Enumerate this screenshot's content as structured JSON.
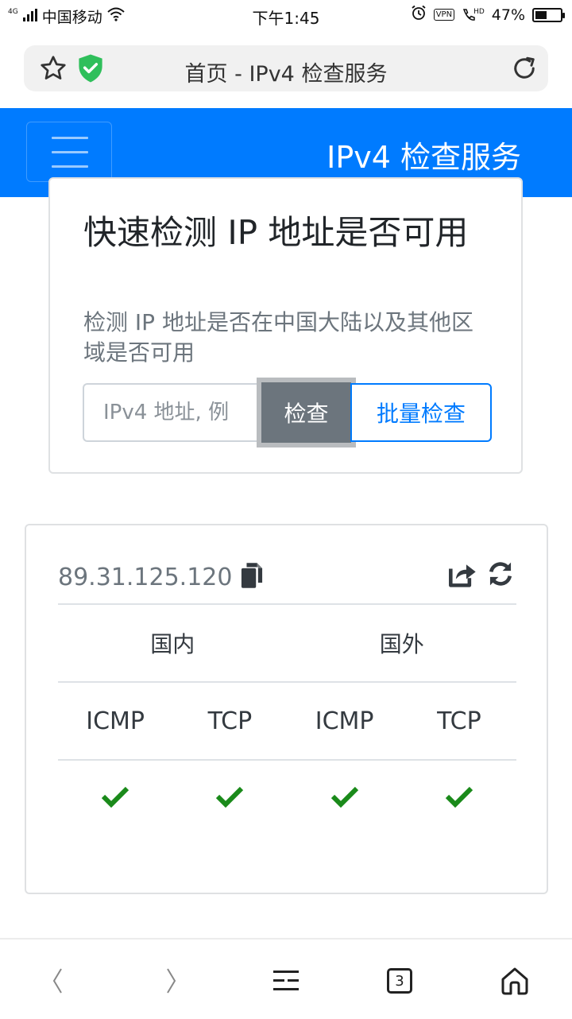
{
  "status_bar": {
    "network": "4G",
    "carrier": "中国移动",
    "time": "下午1:45",
    "vpn": "VPN",
    "hd": "HD",
    "battery": "47%",
    "battery_level": 0.47
  },
  "browser": {
    "page_title": "首页 - IPv4 检查服务",
    "tab_count": "3"
  },
  "navbar": {
    "brand": "IPv4 检查服务"
  },
  "check_card": {
    "title": "快速检测 IP 地址是否可用",
    "subtitle": "检测 IP 地址是否在中国大陆以及其他区域是否可用",
    "input_placeholder": "IPv4 地址, 例",
    "check_button": "检查",
    "batch_button": "批量检查"
  },
  "result": {
    "ip": "89.31.125.120",
    "regions": [
      "国内",
      "国外"
    ],
    "protocols": [
      "ICMP",
      "TCP",
      "ICMP",
      "TCP"
    ],
    "statuses": [
      "ok",
      "ok",
      "ok",
      "ok"
    ]
  },
  "colors": {
    "primary": "#007bff",
    "secondary": "#6c757d",
    "success": "#1a8a1a",
    "shield": "#2fbf5b"
  }
}
